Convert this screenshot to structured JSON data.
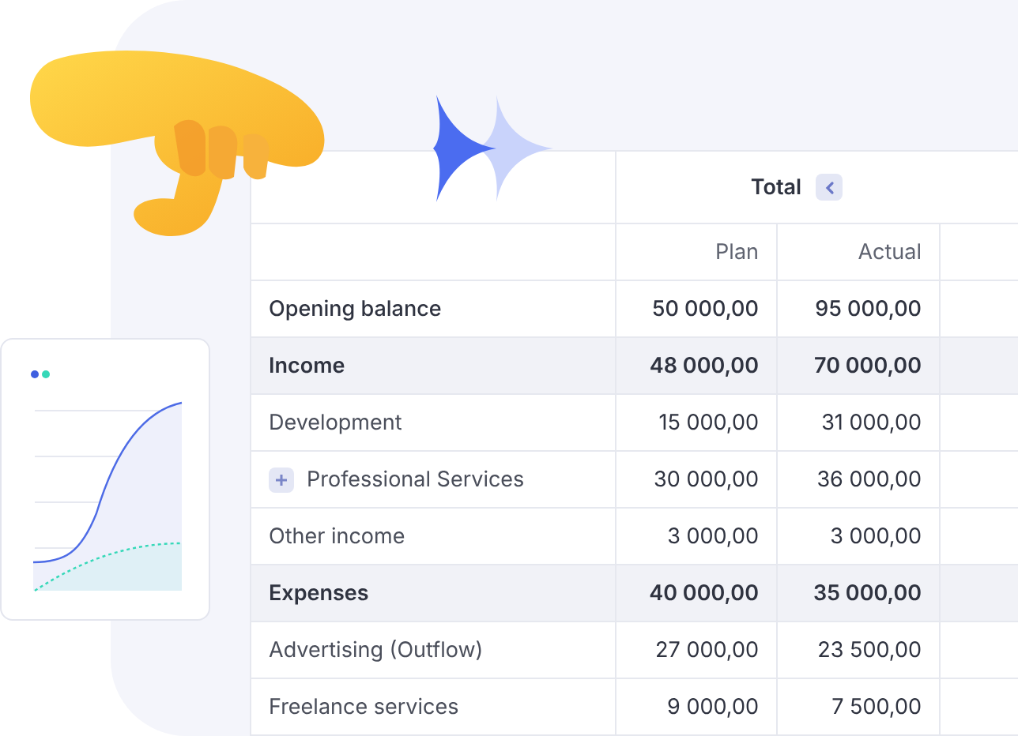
{
  "table": {
    "group_header": "Total",
    "columns": [
      "Plan",
      "Actual"
    ],
    "rows": [
      {
        "kind": "total",
        "label": "Opening balance",
        "values": [
          "50 000,00",
          "95 000,00"
        ]
      },
      {
        "kind": "section",
        "label": "Income",
        "values": [
          "48 000,00",
          "70 000,00"
        ]
      },
      {
        "kind": "item",
        "label": "Development",
        "values": [
          "15 000,00",
          "31 000,00"
        ]
      },
      {
        "kind": "expandable",
        "expanded": false,
        "label": "Professional Services",
        "values": [
          "30 000,00",
          "36 000,00"
        ]
      },
      {
        "kind": "item",
        "label": "Other income",
        "values": [
          "3 000,00",
          "3 000,00"
        ]
      },
      {
        "kind": "section",
        "label": "Expenses",
        "values": [
          "40 000,00",
          "35 000,00"
        ]
      },
      {
        "kind": "item",
        "label": "Advertising (Outflow)",
        "values": [
          "27 000,00",
          "23 500,00"
        ]
      },
      {
        "kind": "item",
        "label": "Freelance services",
        "values": [
          "9 000,00",
          "7 500,00"
        ]
      }
    ]
  }
}
